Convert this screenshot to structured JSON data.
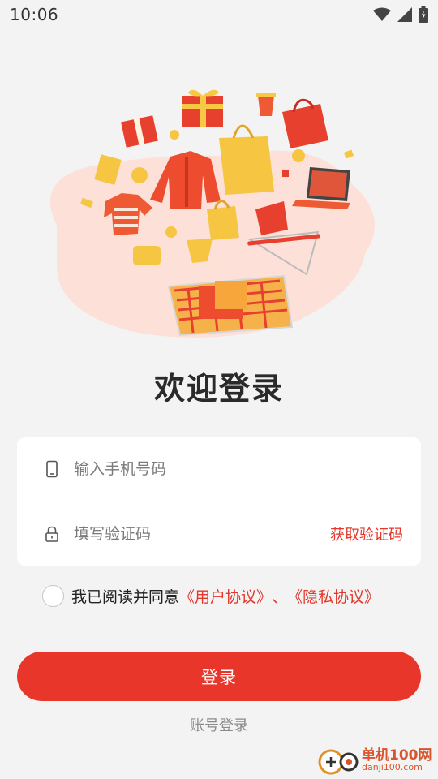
{
  "status_bar": {
    "time": "10:06",
    "icons": [
      "wifi-icon",
      "signal-icon",
      "battery-icon"
    ]
  },
  "hero": {
    "illustration": "shopping-illustration"
  },
  "welcome_title": "欢迎登录",
  "login_form": {
    "phone_placeholder": "输入手机号码",
    "code_placeholder": "填写验证码",
    "get_code_label": "获取验证码"
  },
  "agreement": {
    "prefix": "我已阅读并同意",
    "user_agreement": "《用户协议》",
    "separator": "、",
    "privacy_policy": "《隐私协议》"
  },
  "login_button": "登录",
  "account_login": "账号登录",
  "watermark": {
    "title": "单机100网",
    "url": "danji100.com"
  },
  "colors": {
    "accent": "#e8362a",
    "background": "#f3f3f3"
  }
}
